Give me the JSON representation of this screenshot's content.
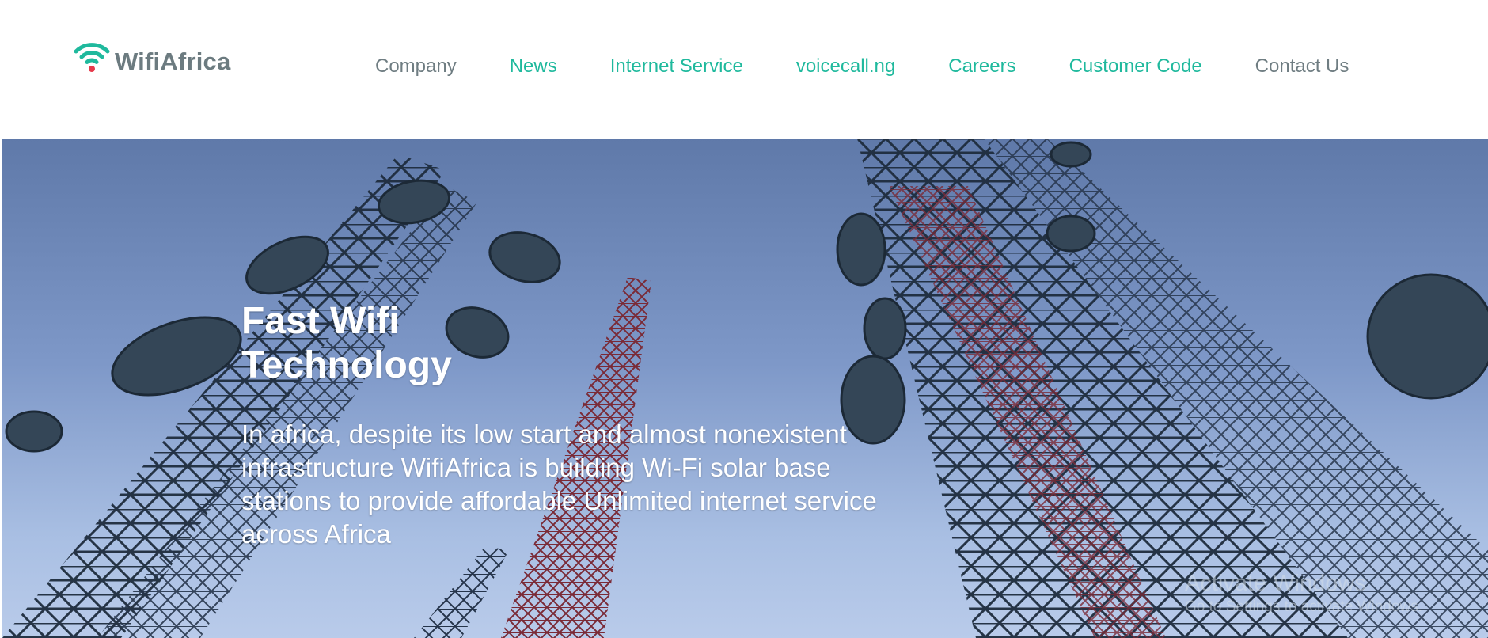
{
  "brand": {
    "name": "WifiAfrica",
    "icon": "wifi-signal-icon",
    "colors": {
      "accent": "#1fb99d",
      "dot": "#e6394a",
      "text": "#6c7b80"
    }
  },
  "nav": {
    "items": [
      {
        "label": "Company",
        "color": "#6f7d82"
      },
      {
        "label": "News",
        "color": "#1fb99d"
      },
      {
        "label": "Internet Service",
        "color": "#1fb99d"
      },
      {
        "label": "voicecall.ng",
        "color": "#1fb99d"
      },
      {
        "label": "Careers",
        "color": "#1fb99d"
      },
      {
        "label": "Customer Code",
        "color": "#1fb99d"
      },
      {
        "label": "Contact Us",
        "color": "#6f7d82"
      }
    ]
  },
  "hero": {
    "title": "Fast Wifi Technology",
    "body": "In africa, despite its low start and almost nonexistent infrastructure WifiAfrica is building Wi-Fi solar base stations to provide affordable Unlimited internet service across Africa",
    "background": "telecom-towers-photo"
  },
  "watermark": {
    "title": "Activate Windows",
    "subtitle": "Go to Settings to activate Windows."
  }
}
